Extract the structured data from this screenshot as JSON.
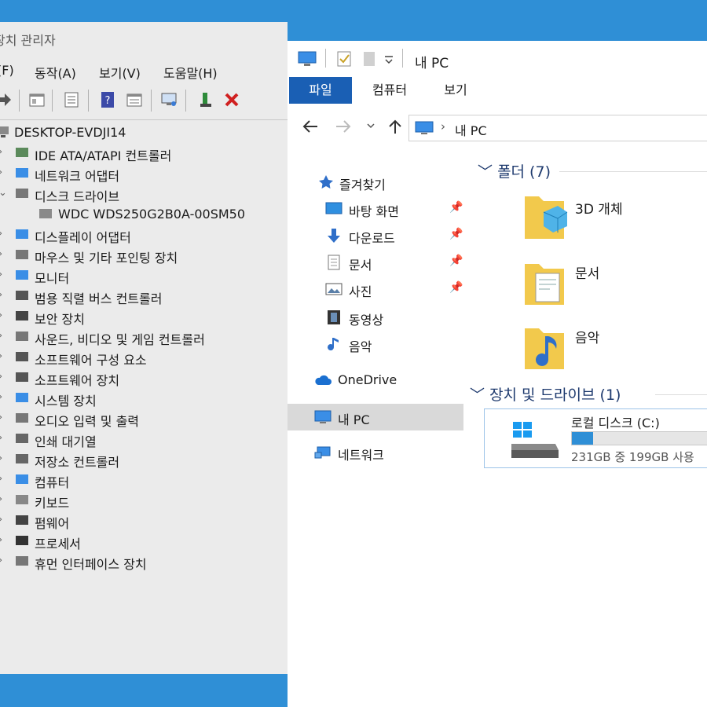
{
  "device_manager": {
    "title": "장치 관리자",
    "menu": [
      "(F)",
      "동작(A)",
      "보기(V)",
      "도움말(H)"
    ],
    "tree_root": "DESKTOP-EVDJI14",
    "nodes": [
      {
        "label": "IDE ATA/ATAPI 컨트롤러",
        "icon": "ide-controller-icon",
        "expanded": false
      },
      {
        "label": "네트워크 어댑터",
        "icon": "network-adapter-icon",
        "expanded": false
      },
      {
        "label": "디스크 드라이브",
        "icon": "disk-drive-icon",
        "expanded": true
      },
      {
        "label": "WDC  WDS250G2B0A-00SM50",
        "icon": "disk-icon",
        "child": true
      },
      {
        "label": "디스플레이 어댑터",
        "icon": "display-adapter-icon",
        "expanded": false
      },
      {
        "label": "마우스 및 기타 포인팅 장치",
        "icon": "mouse-icon",
        "expanded": false
      },
      {
        "label": "모니터",
        "icon": "monitor-icon",
        "expanded": false
      },
      {
        "label": "범용 직렬 버스 컨트롤러",
        "icon": "usb-icon",
        "expanded": false
      },
      {
        "label": "보안 장치",
        "icon": "security-device-icon",
        "expanded": false
      },
      {
        "label": "사운드, 비디오 및 게임 컨트롤러",
        "icon": "speaker-icon",
        "expanded": false
      },
      {
        "label": "소프트웨어 구성 요소",
        "icon": "software-component-icon",
        "expanded": false
      },
      {
        "label": "소프트웨어 장치",
        "icon": "software-device-icon",
        "expanded": false
      },
      {
        "label": "시스템 장치",
        "icon": "system-device-icon",
        "expanded": false
      },
      {
        "label": "오디오 입력 및 출력",
        "icon": "audio-io-icon",
        "expanded": false
      },
      {
        "label": "인쇄 대기열",
        "icon": "printer-icon",
        "expanded": false
      },
      {
        "label": "저장소 컨트롤러",
        "icon": "storage-controller-icon",
        "expanded": false
      },
      {
        "label": "컴퓨터",
        "icon": "computer-icon",
        "expanded": false
      },
      {
        "label": "키보드",
        "icon": "keyboard-icon",
        "expanded": false
      },
      {
        "label": "펌웨어",
        "icon": "firmware-icon",
        "expanded": false
      },
      {
        "label": "프로세서",
        "icon": "processor-icon",
        "expanded": false
      },
      {
        "label": "휴먼 인터페이스 장치",
        "icon": "hid-icon",
        "expanded": false
      }
    ]
  },
  "explorer": {
    "title": "내 PC",
    "ribbon_tabs": [
      "파일",
      "컴퓨터",
      "보기"
    ],
    "address": "내 PC",
    "nav": {
      "quick_access": "즐겨찾기",
      "pinned": [
        "바탕 화면",
        "다운로드",
        "문서",
        "사진"
      ],
      "other": [
        "동영상",
        "음악"
      ],
      "onedrive": "OneDrive",
      "this_pc": "내 PC",
      "network": "네트워크"
    },
    "folders_header": "폴더 (7)",
    "folders": [
      "3D 개체",
      "문서",
      "음악"
    ],
    "drives_header": "장치 및 드라이브 (1)",
    "drive": {
      "name": "로컬 디스크 (C:)",
      "usage_text": "231GB 중 199GB 사용",
      "used_fraction": 0.14
    }
  },
  "colors": {
    "accent": "#1a5fb4",
    "desktop": "#2f8fd6",
    "selected_nav": "#d9d9d9",
    "folder_yellow": "#f2c94c",
    "drive_bar": "#2f8fd6"
  }
}
